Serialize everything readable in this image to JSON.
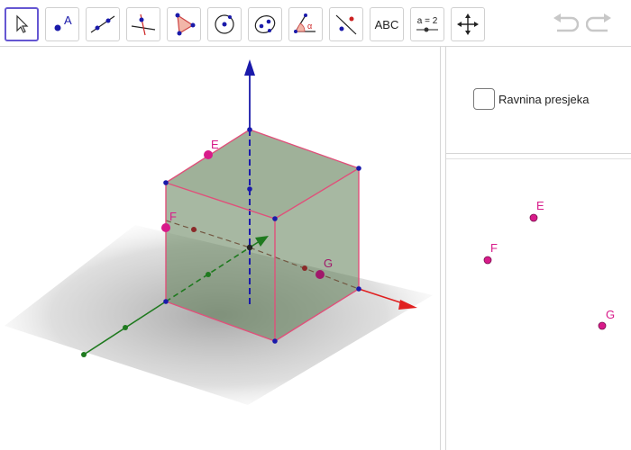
{
  "toolbar": {
    "tools": [
      {
        "name": "move-tool",
        "icon": "arrow-cursor-icon"
      },
      {
        "name": "point-tool",
        "icon": "point-icon",
        "label": "A"
      },
      {
        "name": "line-tool",
        "icon": "line-icon"
      },
      {
        "name": "perpendicular-line-tool",
        "icon": "perpendicular-line-icon"
      },
      {
        "name": "polygon-tool",
        "icon": "polygon-icon"
      },
      {
        "name": "circle-tool",
        "icon": "circle-with-center-icon"
      },
      {
        "name": "ellipse-tool",
        "icon": "ellipse-icon"
      },
      {
        "name": "angle-tool",
        "icon": "angle-icon",
        "label": "α"
      },
      {
        "name": "reflect-tool",
        "icon": "reflect-about-line-icon"
      },
      {
        "name": "text-tool",
        "icon": "text-icon",
        "label": "ABC"
      },
      {
        "name": "slider-tool",
        "icon": "slider-icon",
        "label": "a = 2"
      },
      {
        "name": "move-view-tool",
        "icon": "move-graphics-view-icon"
      }
    ],
    "undo_icon": "undo-icon",
    "redo_icon": "redo-icon"
  },
  "view3d": {
    "points": {
      "E": "E",
      "F": "F",
      "G": "G"
    }
  },
  "view2d": {
    "checkbox_label": "Ravnina presjeka",
    "checkbox_checked": false,
    "points": {
      "E": "E",
      "F": "F",
      "G": "G"
    }
  },
  "colors": {
    "accent": "#6557d2",
    "point_magenta": "#d81b8a",
    "cube_fill": "#5f7d55",
    "cube_edge": "#e0507a",
    "x_axis": "#e02020",
    "y_axis": "#1f7a1f",
    "z_axis": "#1a1aaa",
    "vertex_blue": "#1a1aaa"
  }
}
